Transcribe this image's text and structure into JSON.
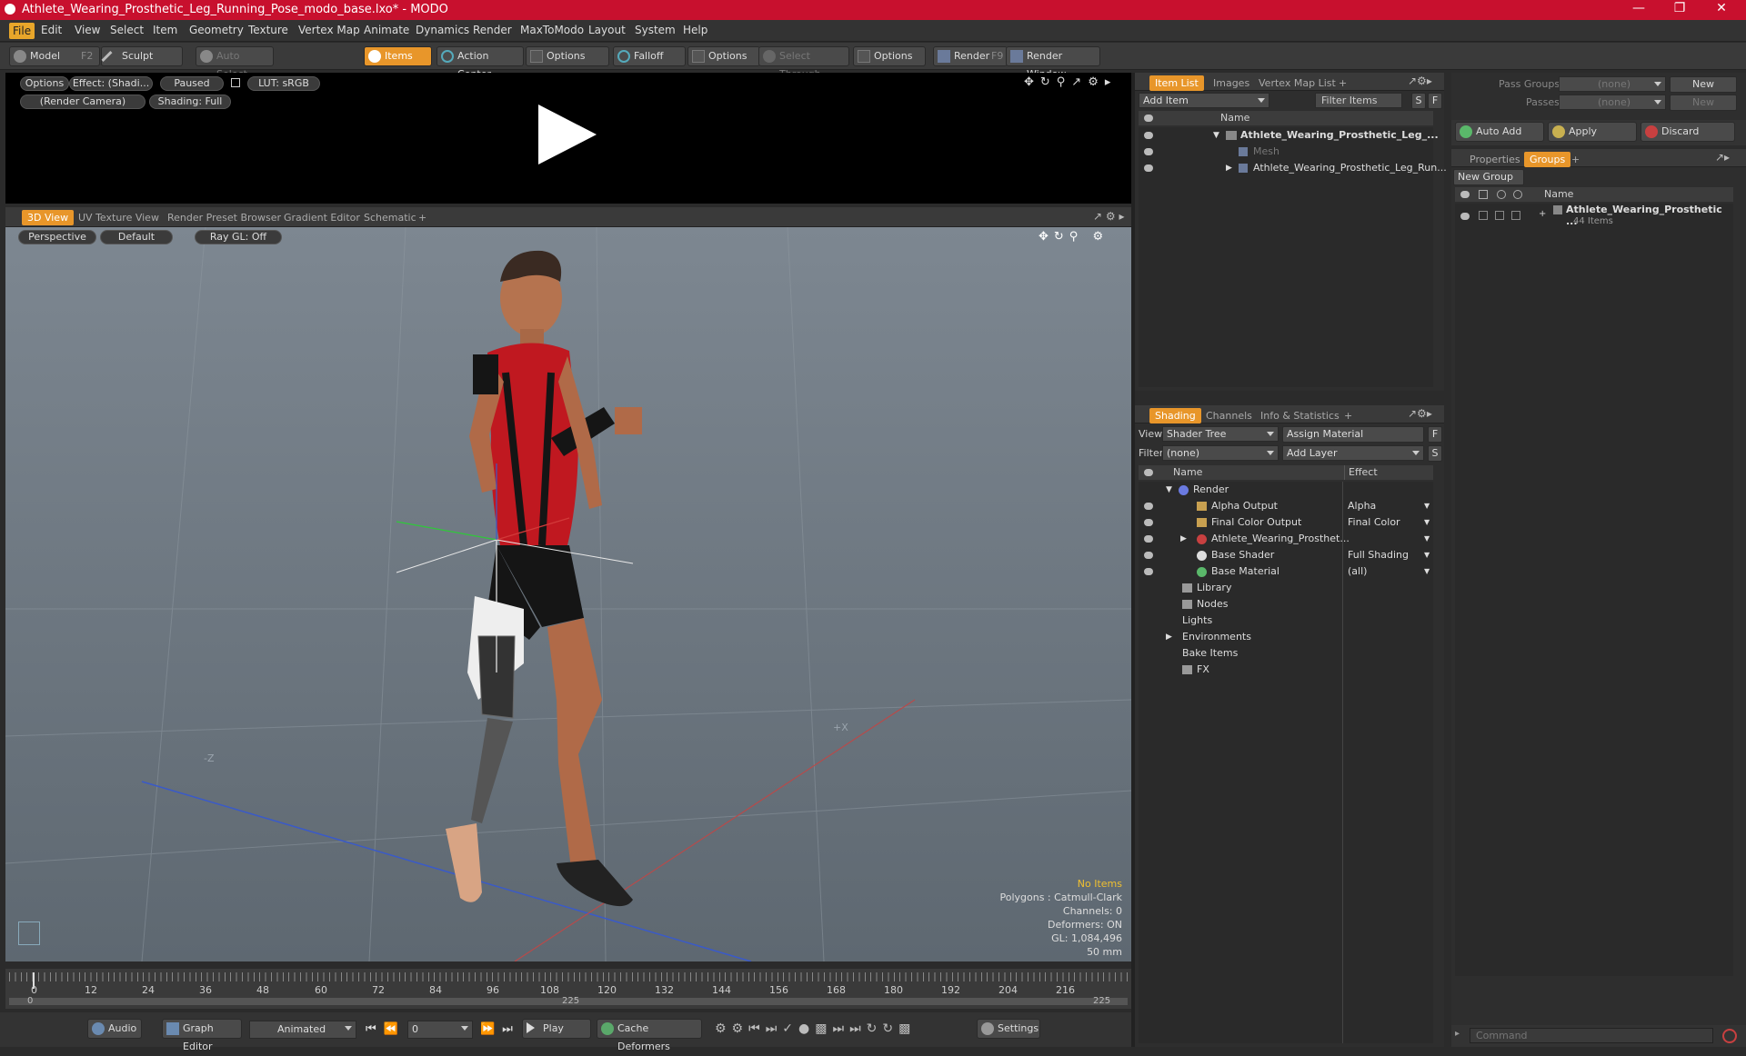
{
  "window": {
    "title": "Athlete_Wearing_Prosthetic_Leg_Running_Pose_modo_base.lxo* - MODO"
  },
  "menu": [
    "File",
    "Edit",
    "View",
    "Select",
    "Item",
    "Geometry",
    "Texture",
    "Vertex Map",
    "Animate",
    "Dynamics",
    "Render",
    "MaxToModo",
    "Layout",
    "System",
    "Help"
  ],
  "toolbar": {
    "model": "Model",
    "model_key": "F2",
    "sculpt": "Sculpt",
    "auto_select": "Auto Select",
    "items": "Items",
    "action_center": "Action Center",
    "options1": "Options",
    "falloff": "Falloff",
    "options2": "Options",
    "select_through": "Select Through",
    "options3": "Options",
    "render": "Render",
    "render_key": "F9",
    "render_window": "Render Window"
  },
  "render_view": {
    "options": "Options",
    "effect": "Effect: (Shadi...",
    "paused": "Paused",
    "lut": "LUT: sRGB",
    "camera": "(Render Camera)",
    "shading": "Shading: Full"
  },
  "view_tabs": [
    "3D View",
    "UV Texture View",
    "Render Preset Browser",
    "Gradient Editor",
    "Schematic",
    "+"
  ],
  "viewport": {
    "perspective": "Perspective",
    "default": "Default",
    "raygl": "Ray GL: Off",
    "stats": [
      "No Items",
      "Polygons : Catmull-Clark",
      "Channels: 0",
      "Deformers: ON",
      "GL: 1,084,496",
      "50 mm"
    ],
    "axis_z": "-Z",
    "axis_x": "+X"
  },
  "timeline": {
    "ticks": [
      "0",
      "12",
      "24",
      "36",
      "48",
      "60",
      "72",
      "84",
      "96",
      "108",
      "120",
      "132",
      "144",
      "156",
      "168",
      "180",
      "192",
      "204",
      "216"
    ],
    "range": [
      "0",
      "225",
      "225"
    ]
  },
  "bottombar": {
    "audio": "Audio",
    "graph_editor": "Graph Editor",
    "animated": "Animated",
    "frame": "0",
    "play": "Play",
    "cache": "Cache Deformers",
    "settings": "Settings"
  },
  "itemlist": {
    "tabs": [
      "Item List",
      "Images",
      "Vertex Map List",
      "+"
    ],
    "add_item": "Add Item",
    "filter": "Filter Items",
    "s": "S",
    "f": "F",
    "col_name": "Name",
    "rows": [
      "Athlete_Wearing_Prosthetic_Leg_...",
      "Mesh",
      "Athlete_Wearing_Prosthetic_Leg_Run..."
    ]
  },
  "shading": {
    "tabs": [
      "Shading",
      "Channels",
      "Info & Statistics",
      "+"
    ],
    "view_label": "View",
    "view_value": "Shader Tree",
    "assign": "Assign Material",
    "f": "F",
    "filter_label": "Filter",
    "filter_value": "(none)",
    "add_layer": "Add Layer",
    "s": "S",
    "col_name": "Name",
    "col_effect": "Effect",
    "rows": [
      {
        "name": "Render",
        "effect": ""
      },
      {
        "name": "Alpha Output",
        "effect": "Alpha"
      },
      {
        "name": "Final Color Output",
        "effect": "Final Color"
      },
      {
        "name": "Athlete_Wearing_Prosthet...",
        "effect": ""
      },
      {
        "name": "Base Shader",
        "effect": "Full Shading"
      },
      {
        "name": "Base Material",
        "effect": "(all)"
      },
      {
        "name": "Library",
        "effect": ""
      },
      {
        "name": "Nodes",
        "effect": ""
      },
      {
        "name": "Lights",
        "effect": ""
      },
      {
        "name": "Environments",
        "effect": ""
      },
      {
        "name": "Bake Items",
        "effect": ""
      },
      {
        "name": "FX",
        "effect": ""
      }
    ]
  },
  "passes": {
    "pass_groups": "Pass Groups",
    "passes": "Passes",
    "none1": "(none)",
    "none2": "(none)",
    "new1": "New",
    "new2": "New",
    "auto_add": "Auto Add",
    "apply": "Apply",
    "discard": "Discard"
  },
  "groups": {
    "tabs": [
      "Properties",
      "Groups",
      "+"
    ],
    "new_group": "New Group",
    "col_name": "Name",
    "group_name": "Athlete_Wearing_Prosthetic ...",
    "count": "44 Items"
  },
  "command": {
    "placeholder": "Command"
  }
}
